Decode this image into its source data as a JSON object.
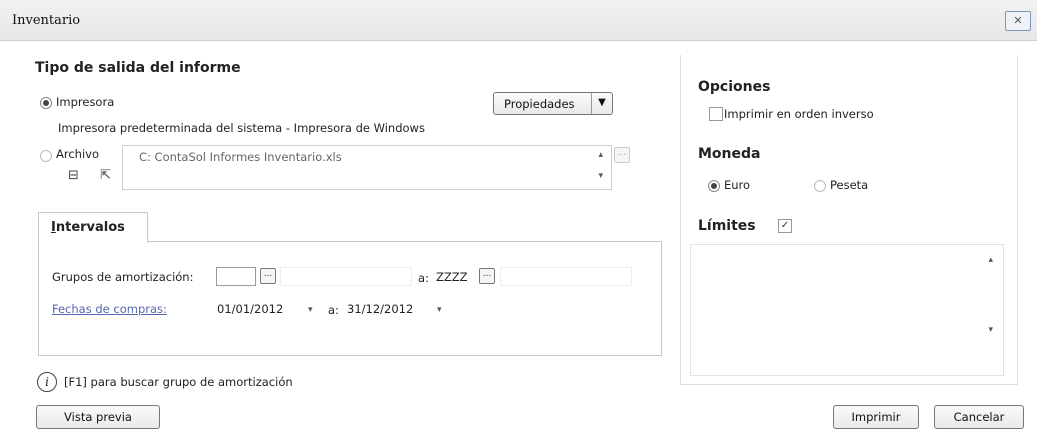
{
  "window": {
    "title": "Inventario",
    "close_label": "✕"
  },
  "output": {
    "section_title": "Tipo de salida del informe",
    "printer_label": "Impresora",
    "printer_description": "Impresora predeterminada del sistema - Impresora de Windows",
    "properties_label": "Propiedades",
    "file_label": "Archivo",
    "file_path": "C: ContaSol Informes Inventario.xls"
  },
  "options": {
    "section_title": "Opciones",
    "reverse_print_label": "Imprimir en orden inverso"
  },
  "currency": {
    "section_title": "Moneda",
    "euro_label": "Euro",
    "peseta_label": "Peseta",
    "selected": "Euro"
  },
  "limits": {
    "label": "Límites",
    "checked": true
  },
  "intervals": {
    "tab_label_underlined": "I",
    "tab_label_rest": "ntervalos",
    "groups_label": "Grupos de amortización:",
    "groups_from": "",
    "groups_to_label": "a:",
    "groups_to": "ZZZZ",
    "dates_label": "Fechas de compras:",
    "date_from": "01/01/2012",
    "date_to_label": "a:",
    "date_to": "31/12/2012",
    "ellipsis": "..."
  },
  "info_text": "[F1] para buscar grupo de amortización",
  "buttons": {
    "preview": "Vista previa",
    "print": "Imprimir",
    "cancel": "Cancelar"
  }
}
